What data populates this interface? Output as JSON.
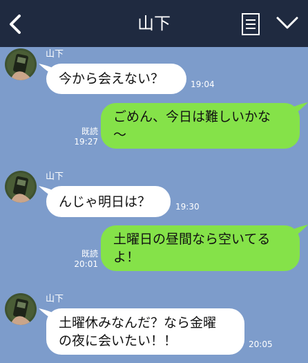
{
  "header": {
    "title": "山下",
    "back_icon": "chevron-left-icon",
    "menu_icon": "notes-icon",
    "expand_icon": "chevron-down-icon"
  },
  "colors": {
    "background": "#7d9ccb",
    "header": "#1f2a40",
    "incoming_bubble": "#ffffff",
    "outgoing_bubble": "#85e249"
  },
  "messages": [
    {
      "direction": "incoming",
      "sender": "山下",
      "text": "今から会えない？",
      "time": "19:04"
    },
    {
      "direction": "outgoing",
      "lines": [
        "ごめん、今日は難しいかな",
        "〜"
      ],
      "read": "既読",
      "time": "19:27"
    },
    {
      "direction": "incoming",
      "sender": "山下",
      "text": "んじゃ明日は？",
      "time": "19:30"
    },
    {
      "direction": "outgoing",
      "lines": [
        "土曜日の昼間なら空いてる",
        "よ！"
      ],
      "read": "既読",
      "time": "20:01"
    },
    {
      "direction": "incoming",
      "sender": "山下",
      "lines": [
        "土曜休みなんだ？なら金曜",
        "の夜に会いたい！！"
      ],
      "time": "20:05"
    }
  ]
}
